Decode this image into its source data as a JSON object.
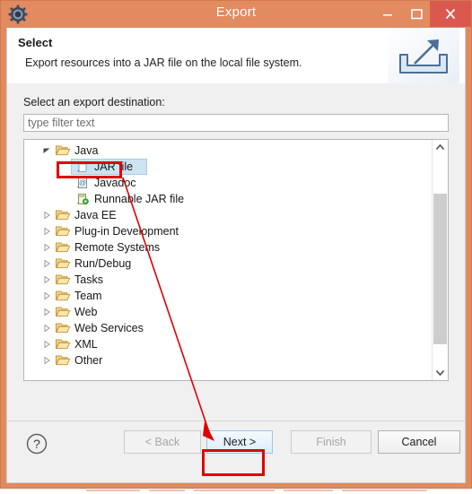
{
  "window": {
    "title": "Export",
    "app_icon": "gear-icon",
    "controls": {
      "minimize": "minimize-icon",
      "maximize": "maximize-icon",
      "close": "close-icon"
    },
    "titlebar_color": "#e28a60",
    "close_button_color": "#d9594f",
    "border_color": "#d2784e"
  },
  "banner": {
    "title": "Select",
    "description": "Export resources into a JAR file on the local file system.",
    "icon": "export-wizard-icon"
  },
  "destination": {
    "label": "Select an export destination:",
    "filter": {
      "value": "",
      "placeholder": "type filter text"
    }
  },
  "tree": {
    "items": [
      {
        "label": "Java",
        "depth": 0,
        "state": "expanded",
        "icon": "open-folder-icon",
        "selected": false
      },
      {
        "label": "JAR file",
        "depth": 1,
        "state": "leaf",
        "icon": "jar-file-icon",
        "selected": true
      },
      {
        "label": "Javadoc",
        "depth": 1,
        "state": "leaf",
        "icon": "javadoc-icon",
        "selected": false
      },
      {
        "label": "Runnable JAR file",
        "depth": 1,
        "state": "leaf",
        "icon": "runnable-jar-file-icon",
        "selected": false
      },
      {
        "label": "Java EE",
        "depth": 0,
        "state": "collapsed",
        "icon": "open-folder-icon",
        "selected": false
      },
      {
        "label": "Plug-in Development",
        "depth": 0,
        "state": "collapsed",
        "icon": "open-folder-icon",
        "selected": false
      },
      {
        "label": "Remote Systems",
        "depth": 0,
        "state": "collapsed",
        "icon": "open-folder-icon",
        "selected": false
      },
      {
        "label": "Run/Debug",
        "depth": 0,
        "state": "collapsed",
        "icon": "open-folder-icon",
        "selected": false
      },
      {
        "label": "Tasks",
        "depth": 0,
        "state": "collapsed",
        "icon": "open-folder-icon",
        "selected": false
      },
      {
        "label": "Team",
        "depth": 0,
        "state": "collapsed",
        "icon": "open-folder-icon",
        "selected": false
      },
      {
        "label": "Web",
        "depth": 0,
        "state": "collapsed",
        "icon": "open-folder-icon",
        "selected": false
      },
      {
        "label": "Web Services",
        "depth": 0,
        "state": "collapsed",
        "icon": "open-folder-icon",
        "selected": false
      },
      {
        "label": "XML",
        "depth": 0,
        "state": "collapsed",
        "icon": "open-folder-icon",
        "selected": false
      },
      {
        "label": "Other",
        "depth": 0,
        "state": "collapsed",
        "icon": "open-folder-icon",
        "selected": false
      }
    ],
    "selection_color": "#cde3f2",
    "scrollbar": {
      "up": "chevron-up-icon",
      "down": "chevron-down-icon"
    }
  },
  "footer": {
    "help": "help-icon",
    "buttons": {
      "back": {
        "label": "< Back",
        "enabled": false
      },
      "next": {
        "label": "Next >",
        "enabled": true
      },
      "finish": {
        "label": "Finish",
        "enabled": false
      },
      "cancel": {
        "label": "Cancel",
        "enabled": true
      }
    }
  },
  "annotations": {
    "highlight_color": "#e00000",
    "boxes": [
      "jar-file-row",
      "next-button"
    ],
    "arrow": {
      "from": "jar-file-row",
      "to": "next-button"
    }
  }
}
